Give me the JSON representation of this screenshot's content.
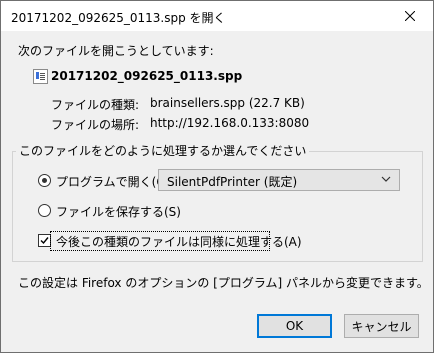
{
  "window": {
    "title": "20171202_092625_0113.spp を開く"
  },
  "intro": "次のファイルを開こうとしています:",
  "file": {
    "name": "20171202_092625_0113.spp",
    "type_label": "ファイルの種類:",
    "type_value": "brainsellers.spp (22.7 KB)",
    "location_label": "ファイルの場所:",
    "location_value": "http://192.168.0.133:8080"
  },
  "action_group": {
    "legend": "このファイルをどのように処理するか選んでください",
    "open_with_label": "プログラムで開く(O):",
    "open_with_selected": "SilentPdfPrinter (既定)",
    "save_label": "ファイルを保存する(S)",
    "remember_label": "今後この種類のファイルは同様に処理する(A)"
  },
  "footer_note": "この設定は Firefox のオプションの [プログラム] パネルから変更できます。",
  "buttons": {
    "ok": "OK",
    "cancel": "キャンセル"
  },
  "state": {
    "open_with_checked": true,
    "save_checked": false,
    "remember_checked": true
  }
}
